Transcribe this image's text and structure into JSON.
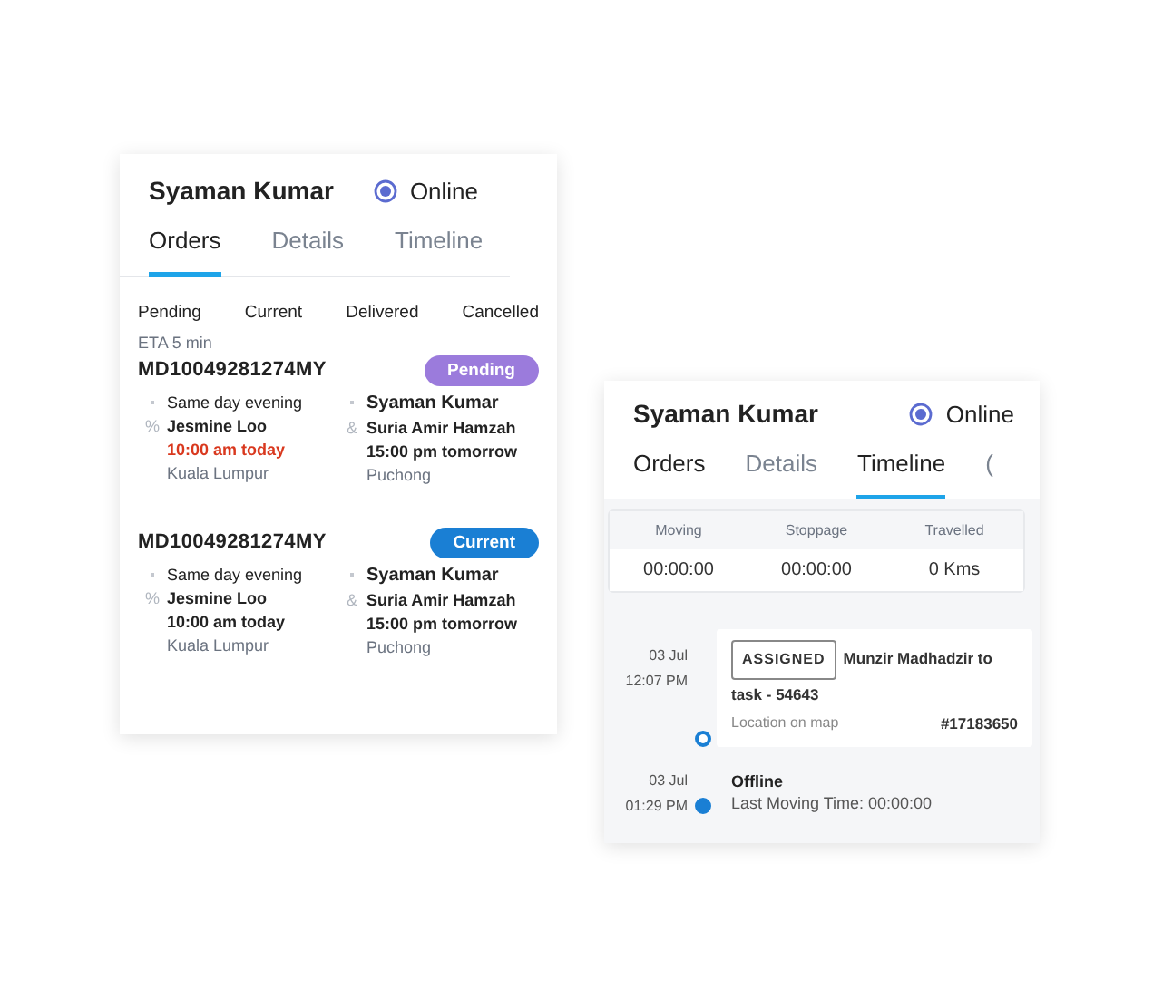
{
  "order_panel": {
    "driver": "Syaman Kumar",
    "status": {
      "label": "Online",
      "on": true
    },
    "tabs": [
      {
        "label": "Orders",
        "selected": true
      },
      {
        "label": "Details",
        "selected": false
      },
      {
        "label": "Timeline",
        "selected": false
      }
    ],
    "filters": [
      {
        "label": "Pending"
      },
      {
        "label": "Current"
      },
      {
        "label": "Delivered"
      },
      {
        "label": "Cancelled"
      }
    ],
    "orders": [
      {
        "eta": "ETA 5 min",
        "id": "MD10049281274MY",
        "status": "Pending",
        "color": "#9b7bdc",
        "pickup": {
          "note": "Same day evening",
          "mark": "%",
          "contact": "Jesmine Loo",
          "time": "10:00 am today",
          "late": true,
          "place": "Kuala Lumpur"
        },
        "drop": {
          "note": "Syaman Kumar",
          "mark": "&",
          "contact": "Suria Amir Hamzah",
          "time": "15:00 pm tomorrow",
          "place": "Puchong"
        }
      },
      {
        "id": "MD10049281274MY",
        "status": "Current",
        "color": "#1a7fd4",
        "pickup": {
          "note": "Same day evening",
          "mark": "%",
          "contact": "Jesmine Loo",
          "time": "10:00 am today",
          "late": false,
          "place": "Kuala Lumpur"
        },
        "drop": {
          "note": "Syaman Kumar",
          "mark": "&",
          "contact": "Suria Amir Hamzah",
          "time": "15:00 pm tomorrow",
          "place": "Puchong"
        }
      }
    ]
  },
  "timeline_panel": {
    "driver": "Syaman Kumar",
    "status": {
      "label": "Online",
      "on": true
    },
    "tabs": [
      {
        "label": "Orders",
        "selected": false
      },
      {
        "label": "Details",
        "selected": false
      },
      {
        "label": "Timeline",
        "selected": true
      },
      {
        "label": "(",
        "selected": false
      }
    ],
    "stats": [
      {
        "label": "Moving",
        "value": "00:00:00"
      },
      {
        "label": "Stoppage",
        "value": "00:00:00"
      },
      {
        "label": "Travelled",
        "value": "0 Kms"
      }
    ],
    "events": [
      {
        "kind": "card",
        "date": "03 Jul",
        "time": "12:07 PM",
        "badge": "ASSIGNED",
        "text": "Munzir Madhadzir to task - 54643",
        "link": "Location on map",
        "ref": "#17183650"
      },
      {
        "kind": "plain",
        "date": "03 Jul",
        "time": "01:29 PM",
        "title": "Offline",
        "detail": "Last Moving Time: 00:00:00"
      }
    ]
  }
}
